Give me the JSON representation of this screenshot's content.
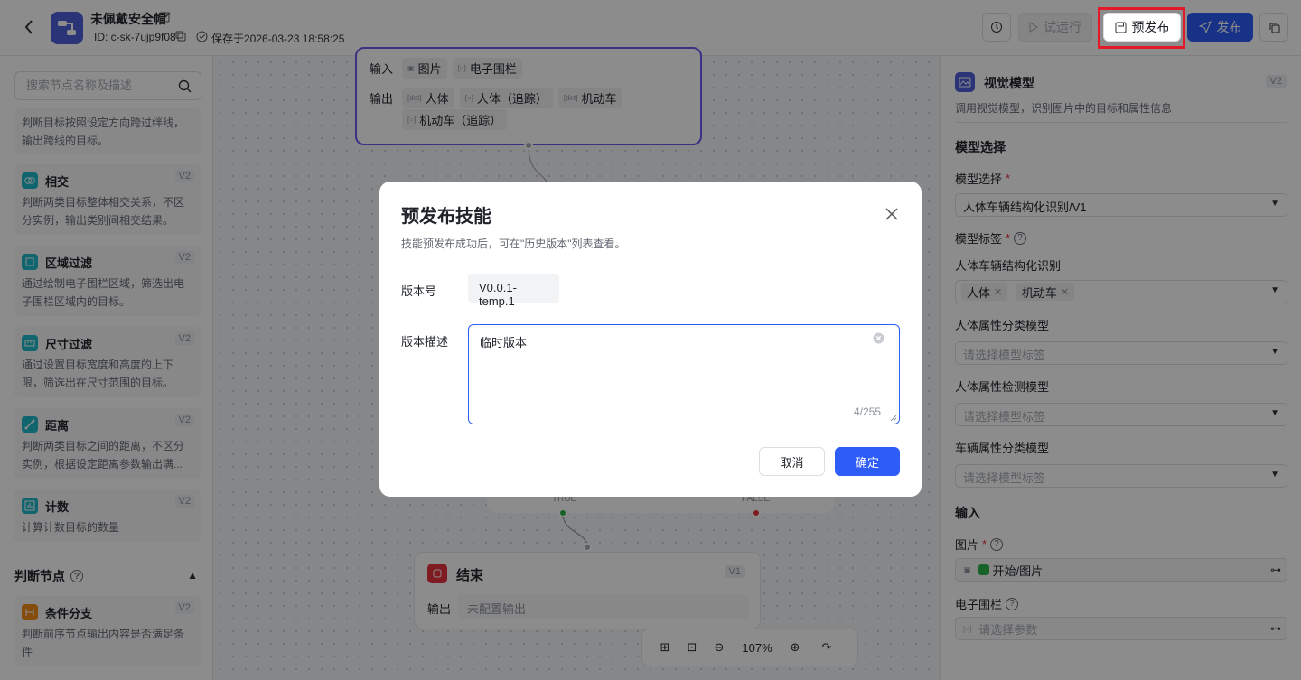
{
  "header": {
    "title": "未佩戴安全帽",
    "id_text": "ID: c-sk-7ujp9f08",
    "save_text": "保存于2026-03-23 18:58:25",
    "test_run_label": "试运行",
    "prepublish_label": "预发布",
    "publish_label": "发布"
  },
  "sidebar": {
    "search_placeholder": "搜索节点名称及描述",
    "items": [
      {
        "name": "",
        "version": "",
        "desc": "判断目标按照设定方向跨过绊线，输出跨线的目标。"
      },
      {
        "name": "相交",
        "version": "V2",
        "desc": "判断两类目标整体相交关系，不区分实例，输出类别间相交结果。"
      },
      {
        "name": "区域过滤",
        "version": "V2",
        "desc": "通过绘制电子围栏区域，筛选出电子围栏区域内的目标。"
      },
      {
        "name": "尺寸过滤",
        "version": "V2",
        "desc": "通过设置目标宽度和高度的上下限，筛选出在尺寸范围的目标。"
      },
      {
        "name": "距离",
        "version": "V2",
        "desc": "判断两类目标之间的距离，不区分实例，根据设定距离参数输出满..."
      },
      {
        "name": "计数",
        "version": "V2",
        "desc": "计算计数目标的数量"
      }
    ],
    "section_title": "判断节点",
    "section_item": {
      "name": "条件分支",
      "version": "V2",
      "desc": "判断前序节点输出内容是否满足条件"
    }
  },
  "canvas": {
    "vision_node": {
      "input_label": "输入",
      "inputs": [
        "图片",
        "电子围栏"
      ],
      "output_label": "输出",
      "outputs": [
        "人体",
        "人体（追踪）",
        "机动车",
        "机动车（追踪）"
      ]
    },
    "branch": {
      "true_label": "TRUE",
      "false_label": "FALSE"
    },
    "end_node": {
      "title": "结束",
      "version": "V1",
      "output_label": "输出",
      "output_value": "未配置输出"
    },
    "zoom": "107%"
  },
  "right_panel": {
    "title": "视觉模型",
    "version": "V2",
    "desc": "调用视觉模型，识别图片中的目标和属性信息",
    "model_section": "模型选择",
    "model_select_label": "模型选择",
    "model_select_value": "人体车辆结构化识别/V1",
    "model_tag_label": "模型标签",
    "group1_label": "人体车辆结构化识别",
    "group1_tags": [
      "人体",
      "机动车"
    ],
    "group2_label": "人体属性分类模型",
    "group2_placeholder": "请选择模型标签",
    "group3_label": "人体属性检测模型",
    "group3_placeholder": "请选择模型标签",
    "group4_label": "车辆属性分类模型",
    "group4_placeholder": "请选择模型标签",
    "input_section": "输入",
    "image_label": "图片",
    "image_value": "开始/图片",
    "fence_label": "电子围栏",
    "fence_placeholder": "请选择参数"
  },
  "modal": {
    "title": "预发布技能",
    "hint": "技能预发布成功后，可在\"历史版本\"列表查看。",
    "version_label": "版本号",
    "version_value": "V0.0.1-temp.1",
    "desc_label": "版本描述",
    "desc_value": "临时版本",
    "char_count": "4/255",
    "cancel_label": "取消",
    "ok_label": "确定"
  },
  "colors": {
    "primary": "#2d5cf6",
    "highlight_box": "#e3192a",
    "node_border": "#6a5cf0"
  }
}
